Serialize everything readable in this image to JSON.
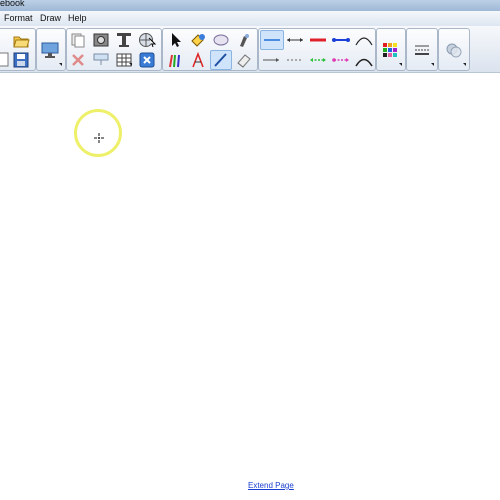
{
  "window": {
    "title": "ebook"
  },
  "menu": {
    "items": [
      "Format",
      "Draw",
      "Help"
    ]
  },
  "toolbar": {
    "colors": {
      "accent": "#1f6fd6",
      "red": "#e0202a",
      "blue": "#1c3fd8",
      "green": "#2bbf3a",
      "pink": "#e03bb5"
    }
  },
  "canvas": {
    "extend_link": "Extend Page"
  }
}
